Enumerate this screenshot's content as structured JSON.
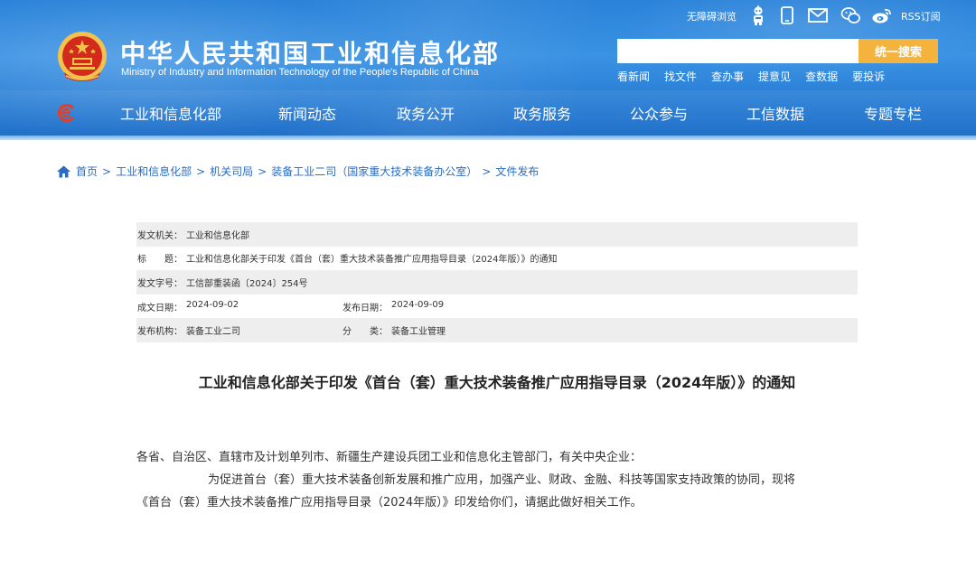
{
  "header": {
    "site_title": "中华人民共和国工业和信息化部",
    "site_subtitle": "Ministry of Industry and Information Technology of the People's Republic of China",
    "accessibility_label": "无障碍浏览",
    "rss_label": "RSS订阅",
    "icons": [
      "robot-icon",
      "phone-icon",
      "mail-icon",
      "wechat-icon",
      "weibo-icon"
    ],
    "search": {
      "placeholder": "",
      "button_label": "统一搜索"
    },
    "quick_links": [
      "看新闻",
      "找文件",
      "查办事",
      "提意见",
      "查数据",
      "要投诉"
    ],
    "colors": {
      "header_blue": "#2b83d9",
      "search_button": "#f4b33d",
      "emblem_red": "#d42a1c",
      "emblem_gold": "#f2c14e"
    }
  },
  "nav": {
    "items": [
      "工业和信息化部",
      "新闻动态",
      "政务公开",
      "政务服务",
      "公众参与",
      "工信数据",
      "专题专栏"
    ]
  },
  "breadcrumb": {
    "items": [
      "首页",
      "工业和信息化部",
      "机关司局",
      "装备工业二司（国家重大技术装备办公室）",
      "文件发布"
    ],
    "separator": ">"
  },
  "meta": {
    "issuer_label": "发文机关：",
    "issuer": "工业和信息化部",
    "title_label": "标　　题：",
    "title": "工业和信息化部关于印发《首台（套）重大技术装备推广应用指导目录（2024年版）》的通知",
    "doc_no_label": "发文字号：",
    "doc_no": "工信部重装函〔2024〕254号",
    "created_label": "成文日期：",
    "created": "2024-09-02",
    "published_label": "发布日期：",
    "published": "2024-09-09",
    "agency_label": "发布机构：",
    "agency": "装备工业二司",
    "category_label": "分　　类：",
    "category": "装备工业管理"
  },
  "document": {
    "heading": "工业和信息化部关于印发《首台（套）重大技术装备推广应用指导目录（2024年版）》的通知",
    "salutation": "各省、自治区、直辖市及计划单列市、新疆生产建设兵团工业和信息化主管部门，有关中央企业：",
    "body_line1": "为促进首台（套）重大技术装备创新发展和推广应用，加强产业、财政、金融、科技等国家支持政策的协同，现将",
    "body_line2": "《首台（套）重大技术装备推广应用指导目录（2024年版）》印发给你们，请据此做好相关工作。"
  }
}
